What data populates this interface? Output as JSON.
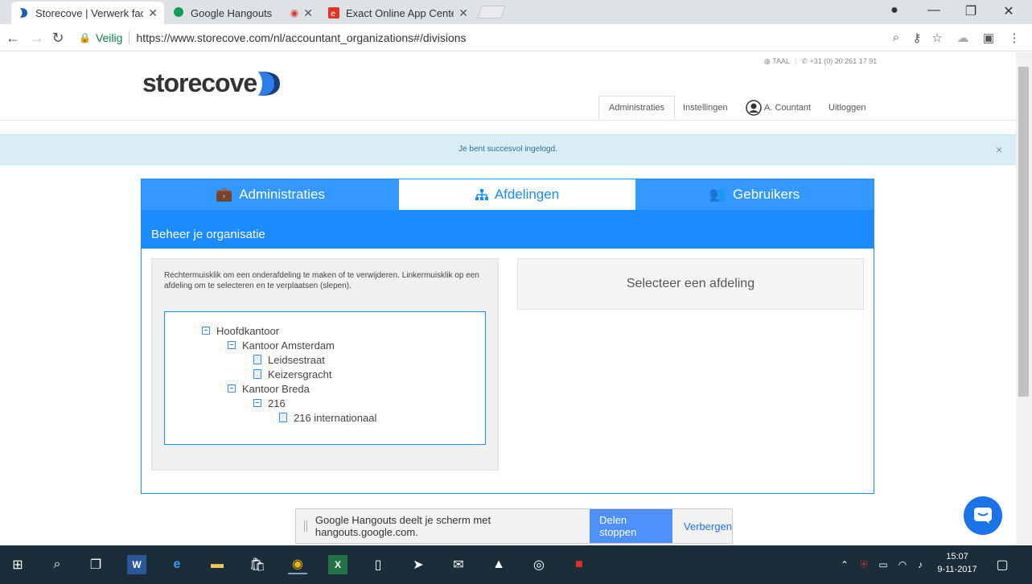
{
  "browser": {
    "tabs": [
      {
        "title": "Storecove | Verwerk factu",
        "active": true
      },
      {
        "title": "Google Hangouts",
        "active": false
      },
      {
        "title": "Exact Online App Center",
        "active": false
      }
    ],
    "secure_label": "Veilig",
    "url": "https://www.storecove.com/nl/accountant_organizations#/divisions"
  },
  "site": {
    "logo_text": "storecove",
    "lang_label": "TAAL",
    "phone": "+31 (0) 20 261 17 91",
    "nav": {
      "administraties": "Administraties",
      "instellingen": "Instellingen",
      "user": "A. Countant",
      "logout": "Uitloggen"
    },
    "alert": "Je bent succesvol ingelogd.",
    "alert_close": "×"
  },
  "panel": {
    "tabs": {
      "administraties": "Administraties",
      "afdelingen": "Afdelingen",
      "gebruikers": "Gebruikers"
    },
    "heading": "Beheer je organisatie",
    "help": "Rechtermuisklik om een onderafdeling te maken of te verwijderen. Linkermuisklik op een afdeling om te selecteren en te verplaatsen (slepen).",
    "tree": [
      {
        "label": "Hoofdkantoor",
        "type": "folder"
      },
      {
        "label": "Kantoor Amsterdam",
        "type": "folder"
      },
      {
        "label": "Leidsestraat",
        "type": "leaf"
      },
      {
        "label": "Keizersgracht",
        "type": "leaf"
      },
      {
        "label": "Kantoor Breda",
        "type": "folder"
      },
      {
        "label": "216",
        "type": "folder"
      },
      {
        "label": "216 internationaal",
        "type": "leaf"
      }
    ],
    "select_prompt": "Selecteer een afdeling"
  },
  "sharebar": {
    "message": "Google Hangouts deelt je scherm met hangouts.google.com.",
    "stop": "Delen stoppen",
    "hide": "Verbergen"
  },
  "taskbar": {
    "time": "15:07",
    "date": "9-11-2017"
  },
  "colors": {
    "brand_blue": "#1a8cff",
    "tab_blue": "#3399ff",
    "alert_bg": "#d9edf7"
  }
}
